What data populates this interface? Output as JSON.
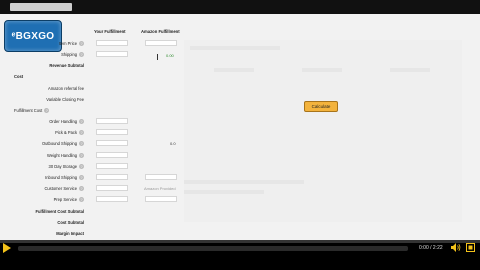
{
  "logo": {
    "text": "ᵉBGXGO"
  },
  "columns": {
    "your": "Your Fulfillment",
    "amazon": "Amazon Fulfillment"
  },
  "rows": [
    {
      "label": "Item Price",
      "help": true,
      "bold": false
    },
    {
      "label": "Shipping",
      "help": true,
      "bold": false
    },
    {
      "label": "Revenue Subtotal",
      "help": false,
      "bold": true
    },
    {
      "label": "Cost",
      "help": false,
      "bold": true
    },
    {
      "label": "Amazon referral fee",
      "help": false,
      "bold": false
    },
    {
      "label": "Variable Closing Fee",
      "help": false,
      "bold": false
    },
    {
      "label": "Fulfillment Cost",
      "help": true,
      "bold": false
    },
    {
      "label": "Order Handling",
      "help": true,
      "bold": false
    },
    {
      "label": "Pick & Pack",
      "help": true,
      "bold": false
    },
    {
      "label": "Outbound Shipping",
      "help": true,
      "bold": false
    },
    {
      "label": "Weight Handling",
      "help": true,
      "bold": false
    },
    {
      "label": "30 Day Storage",
      "help": true,
      "bold": false
    },
    {
      "label": "Inbound Shipping",
      "help": true,
      "bold": false
    },
    {
      "label": "Customer Service",
      "help": true,
      "bold": false
    },
    {
      "label": "Prep Service",
      "help": true,
      "bold": false
    },
    {
      "label": "Fulfillment Cost Subtotal",
      "help": false,
      "bold": true
    },
    {
      "label": "Cost Subtotal",
      "help": false,
      "bold": true
    },
    {
      "label": "Margin Impact",
      "help": false,
      "bold": true
    }
  ],
  "amazon_values": {
    "shipping": "0.00",
    "outbound": "0.0",
    "customer_service": "Amazon Provided"
  },
  "calculate_label": "Calculate",
  "player": {
    "time": "0:00 / 2:22",
    "progress": 0.0
  },
  "colors": {
    "accent": "#f3c21a",
    "button": "#f3b33d",
    "logo": "#1f6fb3"
  },
  "icons": [
    "play-icon",
    "volume-icon",
    "fullscreen-icon",
    "help-icon"
  ]
}
